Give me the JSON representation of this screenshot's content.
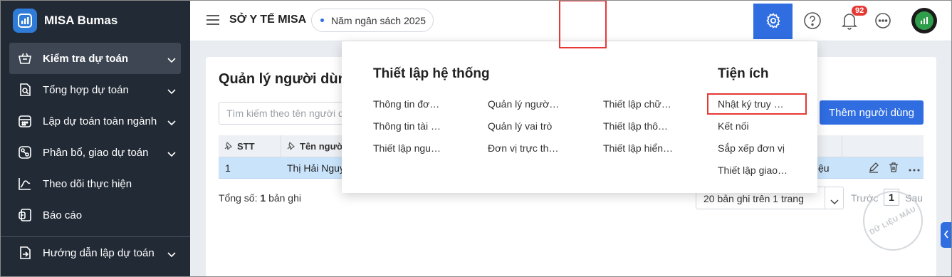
{
  "app": {
    "name": "MISA Bumas"
  },
  "sidebar": {
    "items": [
      {
        "label": "Kiểm tra dự toán",
        "icon": "basket-icon",
        "active": true
      },
      {
        "label": "Tổng hợp dự toán",
        "icon": "document-search-icon"
      },
      {
        "label": "Lập dự toán toàn ngành",
        "icon": "calendar-grid-icon"
      },
      {
        "label": "Phân bổ, giao dự toán",
        "icon": "distribute-icon"
      },
      {
        "label": "Theo dõi thực hiện",
        "icon": "line-chart-icon"
      },
      {
        "label": "Báo cáo",
        "icon": "report-icon"
      },
      {
        "label": "Hướng dẫn lập dự toán",
        "icon": "guide-icon"
      }
    ]
  },
  "header": {
    "org_name": "SỞ Y TẾ MISA",
    "budget_year": "Năm ngân sách 2025",
    "notification_count": "92"
  },
  "main": {
    "title": "Quản lý người dùng",
    "search_placeholder": "Tìm kiếm theo tên người dùng",
    "add_button": "Thêm người dùng",
    "columns": {
      "stt": "STT",
      "name": "Tên người dùng"
    },
    "rows": [
      {
        "stt": "1",
        "name": "Thị Hải Nguyễn",
        "role_tail": "ệu"
      }
    ],
    "total_label": "Tổng số:",
    "total_count": "1",
    "total_suffix": "bản ghi",
    "page_size": "20 bản ghi trên 1 trang",
    "pager_prev": "Trước",
    "pager_current": "1",
    "pager_next": "Sau"
  },
  "settings_menu": {
    "system_heading": "Thiết lập hệ thống",
    "utility_heading": "Tiện ích",
    "col1": [
      "Thông tin đơ…",
      "Thông tin tài …",
      "Thiết lập ngu…"
    ],
    "col2": [
      "Quản lý ngườ…",
      "Quản lý vai trò",
      "Đơn vị trực th…"
    ],
    "col3": [
      "Thiết lập chữ…",
      "Thiết lập thô…",
      "Thiết lập hiển…"
    ],
    "utilities": [
      "Nhật ký truy …",
      "Kết nối",
      "Sắp xếp đơn vị",
      "Thiết lập giao…"
    ]
  },
  "watermark": "DỮ LIỆU MẪU",
  "colors": {
    "primary": "#2f6de1",
    "sidebar": "#222a35",
    "highlight": "#e53935",
    "selected_row": "#c9e3fb"
  }
}
